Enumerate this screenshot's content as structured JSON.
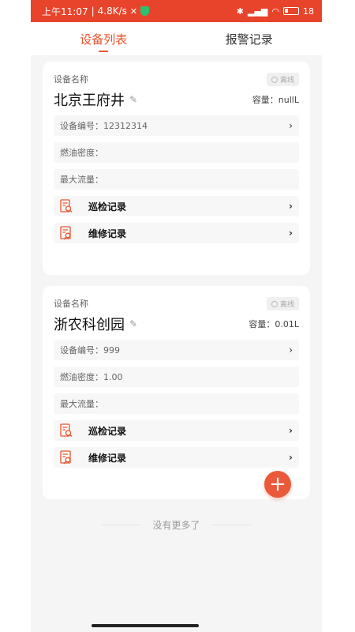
{
  "status_bar": {
    "time": "上午11:07",
    "speed": "4.8K/s",
    "battery": "18"
  },
  "tabs": [
    {
      "label": "设备列表",
      "active": true
    },
    {
      "label": "报警记录",
      "active": false
    }
  ],
  "devices": [
    {
      "name_label": "设备名称",
      "name": "北京王府井",
      "status": "离线",
      "capacity": "容量：nullL",
      "serial": "设备编号：12312314",
      "fuel_density": "燃油密度：",
      "max_flow": "最大流量：",
      "inspection_label": "巡检记录",
      "repair_label": "维修记录"
    },
    {
      "name_label": "设备名称",
      "name": "浙农科创园",
      "status": "离线",
      "capacity": "容量：0.01L",
      "serial": "设备编号：999",
      "fuel_density": "燃油密度：1.00",
      "max_flow": "最大流量：",
      "inspection_label": "巡检记录",
      "repair_label": "维修记录"
    }
  ],
  "footer": {
    "text": "没有更多了"
  },
  "colors": {
    "accent": "#e8542f",
    "statusbar": "#e8442b"
  }
}
